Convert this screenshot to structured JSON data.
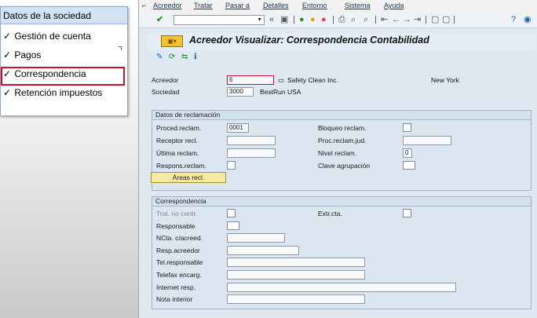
{
  "left_panel": {
    "title": "Datos de la sociedad",
    "check_mark": "✓",
    "items": [
      {
        "label": "Gestión de cuenta",
        "checked": true
      },
      {
        "label": "Pagos",
        "checked": true
      },
      {
        "label": "Correspondencia",
        "checked": true,
        "highlighted": true
      },
      {
        "label": "Retención impuestos",
        "checked": true
      }
    ]
  },
  "menubar": {
    "items": [
      "Acreedor",
      "Tratar",
      "Pasar a",
      "Detalles",
      "Entorno",
      "Sistema",
      "Ayuda"
    ]
  },
  "toolbar": {
    "command_value": "",
    "icons": [
      "checkmark-icon",
      "back-icon",
      "exit-icon",
      "cancel-icon",
      "print-icon",
      "find-icon",
      "help-icon"
    ]
  },
  "screen": {
    "title": "Acreedor Visualizar: Correspondencia Contabilidad",
    "header": {
      "vendor_label": "Acreedor",
      "vendor_value": "6",
      "vendor_name": "Safety Clean Inc.",
      "vendor_city": "New York",
      "company_label": "Sociedad",
      "company_value": "3000",
      "company_name": "BestRun USA"
    },
    "dunning": {
      "title": "Datos de reclamación",
      "proc_label": "Proced.reclam.",
      "proc_value": "0001",
      "recipient_label": "Receptor recl.",
      "recipient_value": "",
      "last_label": "Última reclam.",
      "last_value": "",
      "resp_label": "Respons.reclam.",
      "block_label": "Bloqueo reclam.",
      "legal_label": "Proc.reclam.jud.",
      "legal_value": "",
      "level_label": "Nivel reclam.",
      "level_value": "0",
      "group_label": "Clave agrupación",
      "areas_button": "Áreas recl."
    },
    "correspondence": {
      "title": "Correspondencia",
      "local_label": "Trat. no centr.",
      "extract_label": "Extr.cta.",
      "clerk_label": "Responsable",
      "acct_label": "NCta. c/acreed.",
      "acct_value": "",
      "user_label": "Resp.acreedor",
      "user_value": "",
      "phone_label": "Tel.responsable",
      "phone_value": "",
      "fax_label": "Telefax encarg.",
      "fax_value": "",
      "internet_label": "Internet resp.",
      "internet_value": "",
      "note_label": "Nota interior",
      "note_value": ""
    }
  }
}
